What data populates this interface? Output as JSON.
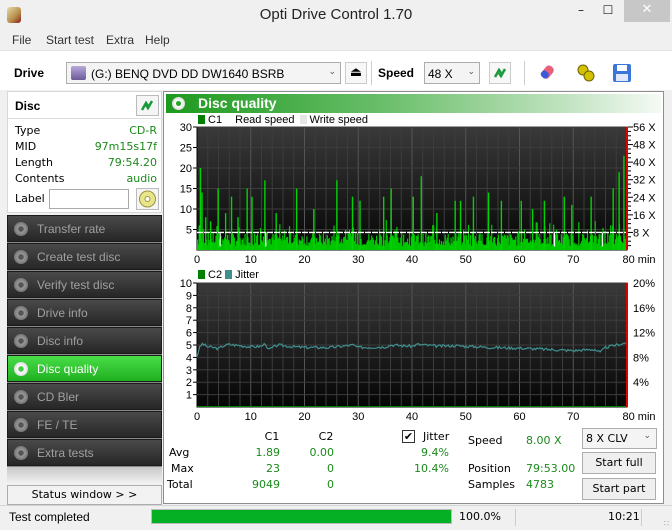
{
  "window": {
    "title": "Opti Drive Control 1.70",
    "minimize_glyph": "–",
    "maximize_glyph": "☐",
    "close_glyph": "✕"
  },
  "menu": [
    "File",
    "Start test",
    "Extra",
    "Help"
  ],
  "toolbar": {
    "drive_label": "Drive",
    "drive_value": "(G:)   BENQ DVD DD DW1640 BSRB",
    "speed_label": "Speed",
    "speed_value": "48 X",
    "eject_glyph": "⏏",
    "dropdown_glyph": "⌄"
  },
  "disc": {
    "title": "Disc",
    "rows": [
      {
        "key": "Type",
        "value": "CD-R"
      },
      {
        "key": "MID",
        "value": "97m15s17f"
      },
      {
        "key": "Length",
        "value": "79:54.20"
      },
      {
        "key": "Contents",
        "value": "audio"
      }
    ],
    "label_key": "Label",
    "label_value": ""
  },
  "nav": [
    {
      "label": "Transfer rate",
      "active": false
    },
    {
      "label": "Create test disc",
      "active": false
    },
    {
      "label": "Verify test disc",
      "active": false
    },
    {
      "label": "Drive info",
      "active": false
    },
    {
      "label": "Disc info",
      "active": false
    },
    {
      "label": "Disc quality",
      "active": true
    },
    {
      "label": "CD Bler",
      "active": false
    },
    {
      "label": "FE / TE",
      "active": false
    },
    {
      "label": "Extra tests",
      "active": false
    }
  ],
  "status_window_btn": "Status window > >",
  "panel_title": "Disc quality",
  "chart_data": [
    {
      "type": "bar",
      "title": "C1",
      "legend": [
        "C1",
        "Read speed",
        "Write speed"
      ],
      "colors": {
        "C1": "#00cc00",
        "Read speed": "#ffffff",
        "Write speed": "#e6e6e6"
      },
      "xlabel": "min",
      "xlim": [
        0,
        80
      ],
      "x_ticks": [
        0,
        10,
        20,
        30,
        40,
        50,
        60,
        70,
        80
      ],
      "x_tick_labels": [
        "0",
        "10",
        "20",
        "30",
        "40",
        "50",
        "60",
        "70",
        "80 min"
      ],
      "ylim": [
        0,
        30
      ],
      "y_ticks": [
        5,
        10,
        15,
        20,
        25,
        30
      ],
      "y2lim": [
        0,
        56
      ],
      "y2_ticks": [
        8,
        16,
        24,
        32,
        40,
        48,
        56
      ],
      "y2_tick_labels": [
        "8 X",
        "16 X",
        "24 X",
        "32 X",
        "40 X",
        "48 X",
        "56 X"
      ],
      "grid": true,
      "c1_avg": 1.89,
      "c1_max": 23,
      "read_speed_x": 8,
      "c1_peaks": [
        [
          0.3,
          6
        ],
        [
          0.5,
          20
        ],
        [
          0.8,
          14
        ],
        [
          1.5,
          8
        ],
        [
          2.4,
          7
        ],
        [
          3.8,
          15
        ],
        [
          5.2,
          9
        ],
        [
          6.3,
          13
        ],
        [
          7.5,
          8
        ],
        [
          9.2,
          15
        ],
        [
          10.1,
          13
        ],
        [
          12.5,
          17
        ],
        [
          14.6,
          9
        ],
        [
          18.4,
          15
        ],
        [
          21.6,
          10
        ],
        [
          25.9,
          17
        ],
        [
          28.8,
          13
        ],
        [
          30.2,
          12
        ],
        [
          34.6,
          13
        ],
        [
          36.0,
          15
        ],
        [
          40.1,
          13
        ],
        [
          41.6,
          18
        ],
        [
          44.5,
          9
        ],
        [
          47.9,
          12
        ],
        [
          48.9,
          12
        ],
        [
          51.3,
          13
        ],
        [
          54.1,
          14
        ],
        [
          56.5,
          12
        ],
        [
          60.2,
          12
        ],
        [
          62.3,
          10
        ],
        [
          64.5,
          12
        ],
        [
          68.2,
          13
        ],
        [
          69.6,
          11
        ],
        [
          73.2,
          13
        ],
        [
          77.3,
          15
        ],
        [
          78.4,
          19
        ],
        [
          79.3,
          23
        ],
        [
          79.8,
          17
        ]
      ]
    },
    {
      "type": "line",
      "title": "C2 / Jitter",
      "legend": [
        "C2",
        "Jitter"
      ],
      "colors": {
        "C2": "#00cc00",
        "Jitter": "#3f8f8f"
      },
      "xlabel": "min",
      "xlim": [
        0,
        80
      ],
      "x_ticks": [
        0,
        10,
        20,
        30,
        40,
        50,
        60,
        70,
        80
      ],
      "x_tick_labels": [
        "0",
        "10",
        "20",
        "30",
        "40",
        "50",
        "60",
        "70",
        "80 min"
      ],
      "ylim": [
        0,
        10
      ],
      "y_ticks": [
        1,
        2,
        3,
        4,
        5,
        6,
        7,
        8,
        9,
        10
      ],
      "y2lim": [
        0,
        20
      ],
      "y2_ticks": [
        4,
        8,
        12,
        16,
        20
      ],
      "y2_tick_labels": [
        "4%",
        "8%",
        "12%",
        "16%",
        "20%"
      ],
      "grid": true,
      "c2_values_all": 0,
      "jitter_percent": [
        [
          0,
          8.2
        ],
        [
          0.5,
          9.6
        ],
        [
          1,
          10.2
        ],
        [
          2,
          9.7
        ],
        [
          3,
          9.6
        ],
        [
          4,
          9.4
        ],
        [
          5,
          9.9
        ],
        [
          6,
          10.1
        ],
        [
          8,
          9.9
        ],
        [
          10,
          9.7
        ],
        [
          12,
          9.8
        ],
        [
          12.8,
          10.3
        ],
        [
          13.2,
          9.2
        ],
        [
          15,
          10.0
        ],
        [
          18,
          9.7
        ],
        [
          20,
          9.6
        ],
        [
          25,
          9.6
        ],
        [
          29,
          10.0
        ],
        [
          30,
          9.6
        ],
        [
          35,
          9.7
        ],
        [
          36,
          10.0
        ],
        [
          40,
          9.8
        ],
        [
          41,
          10.1
        ],
        [
          45,
          9.8
        ],
        [
          48,
          9.9
        ],
        [
          50,
          9.8
        ],
        [
          55,
          9.6
        ],
        [
          60,
          9.5
        ],
        [
          65,
          9.3
        ],
        [
          70,
          9.1
        ],
        [
          74,
          9.3
        ],
        [
          75,
          8.8
        ],
        [
          76,
          9.6
        ],
        [
          78,
          10.0
        ],
        [
          80,
          10.4
        ]
      ]
    }
  ],
  "stats": {
    "col_c1": "C1",
    "col_c2": "C2",
    "col_jitter": "Jitter",
    "jitter_checked": true,
    "check_glyph": "✔",
    "rows": [
      {
        "label": "Avg",
        "c1": "1.89",
        "c2": "0.00",
        "jitter": "9.4%"
      },
      {
        "label": "Max",
        "c1": "23",
        "c2": "0",
        "jitter": "10.4%"
      },
      {
        "label": "Total",
        "c1": "9049",
        "c2": "0",
        "jitter": ""
      }
    ],
    "speed_label": "Speed",
    "speed_value": "8.00 X",
    "position_label": "Position",
    "position_value": "79:53.00",
    "samples_label": "Samples",
    "samples_value": "4783",
    "mode_value": "8 X CLV",
    "start_full": "Start full",
    "start_part": "Start part"
  },
  "statusbar": {
    "text": "Test completed",
    "progress": 1.0,
    "progress_label": "100.0%",
    "time": "10:21"
  }
}
